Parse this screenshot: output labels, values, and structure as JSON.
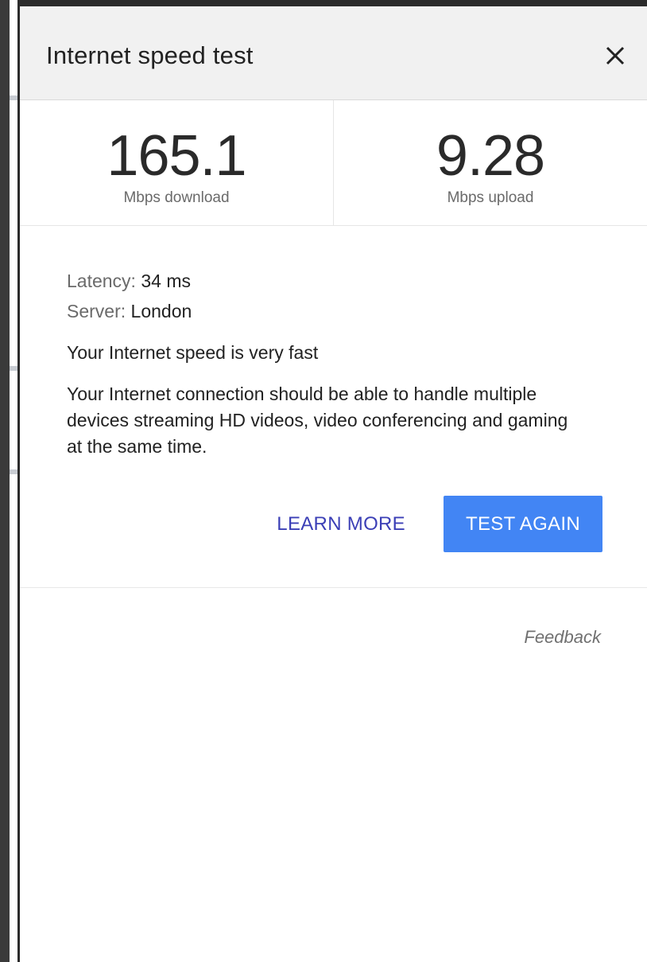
{
  "dialog": {
    "title": "Internet speed test",
    "close_icon": "close-icon"
  },
  "results": {
    "download": {
      "value": "165.1",
      "unit": "Mbps download"
    },
    "upload": {
      "value": "9.28",
      "unit": "Mbps upload"
    }
  },
  "details": {
    "latency_label": "Latency:",
    "latency_value": "34 ms",
    "server_label": "Server:",
    "server_value": "London",
    "summary": "Your Internet speed is very fast",
    "description": "Your Internet connection should be able to handle multiple devices streaming HD videos, video conferencing and gaming at the same time."
  },
  "actions": {
    "learn_more": "LEARN MORE",
    "test_again": "TEST AGAIN"
  },
  "footer": {
    "feedback": "Feedback"
  },
  "colors": {
    "accent": "#4285f4",
    "link": "#3b3fb6",
    "header_bg": "#f1f1f1"
  }
}
